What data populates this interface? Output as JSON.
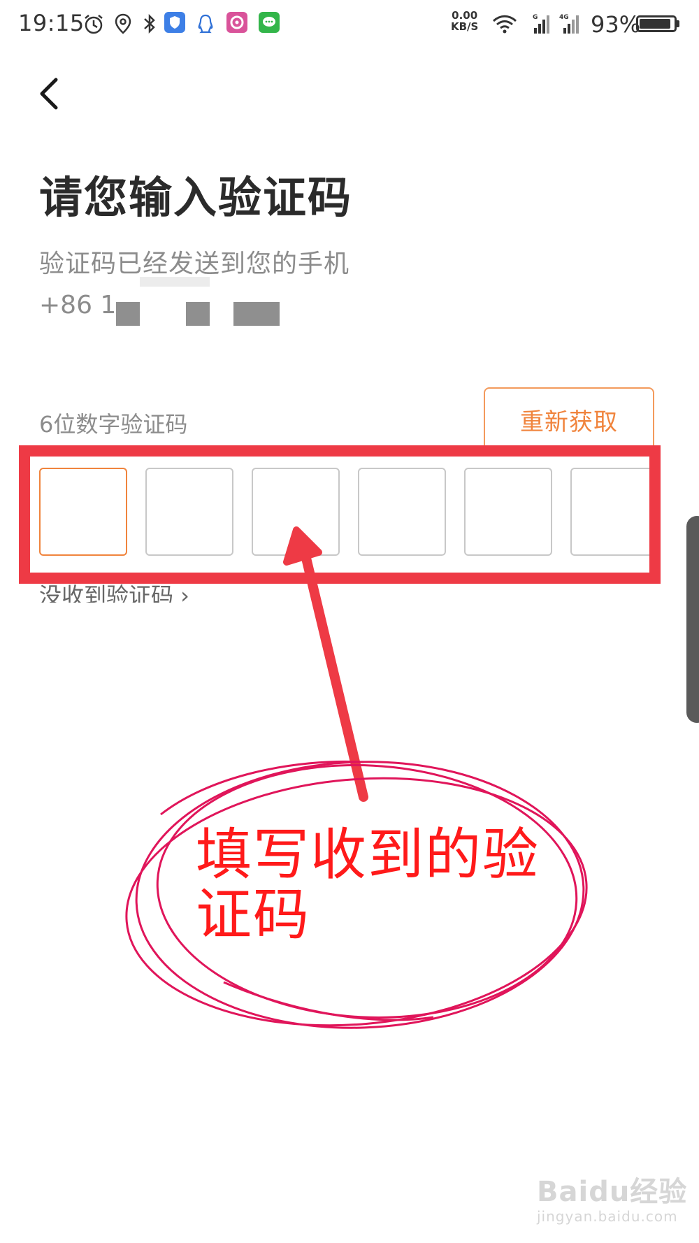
{
  "status_bar": {
    "time": "19:15",
    "net_speed_value": "0.00",
    "net_speed_unit": "KB/S",
    "battery_percent": "93%",
    "battery_level": 0.93,
    "icons": [
      "alarm-icon",
      "location-icon",
      "bluetooth-icon",
      "shield-app-icon",
      "qq-icon",
      "music-app-icon",
      "message-app-icon",
      "wifi-icon",
      "signal-icon",
      "signal-4g-icon"
    ]
  },
  "header": {
    "title": "请您输入验证码",
    "subtitle": "验证码已经发送到您的手机",
    "phone_prefix": "+86 1"
  },
  "code_entry": {
    "label": "6位数字验证码",
    "resend_label": "重新获取",
    "box_count": 6,
    "active_index": 0,
    "no_code_link": "没收到验证码 ›"
  },
  "annotation": {
    "text": "填写收到的验证码"
  },
  "watermark": {
    "brand": "Baidu经验",
    "url": "jingyan.baidu.com"
  },
  "colors": {
    "accent": "#f0843d",
    "annotation_red": "#ee3a45",
    "annotation_pink": "#e0155a",
    "text_primary": "#2b2b2b",
    "text_secondary": "#8c8c8c"
  }
}
